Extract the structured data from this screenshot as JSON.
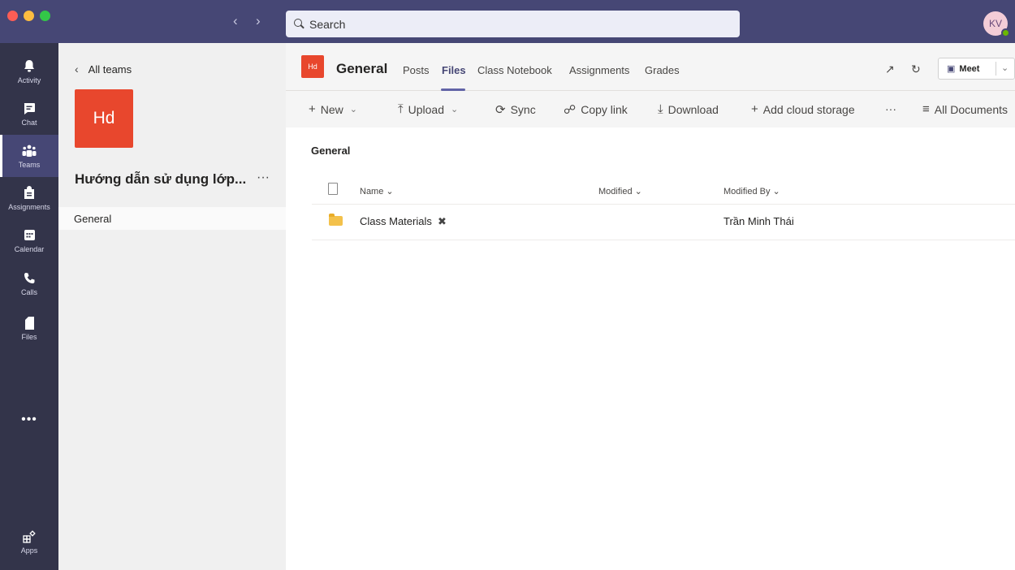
{
  "window": {
    "search_placeholder": "Search",
    "user_initials": "KV"
  },
  "app_bar": {
    "items": [
      {
        "label": "Activity",
        "icon": "bell-icon"
      },
      {
        "label": "Chat",
        "icon": "chat-icon"
      },
      {
        "label": "Teams",
        "icon": "teams-icon"
      },
      {
        "label": "Assignments",
        "icon": "assignments-icon"
      },
      {
        "label": "Calendar",
        "icon": "calendar-icon"
      },
      {
        "label": "Calls",
        "icon": "phone-icon"
      },
      {
        "label": "Files",
        "icon": "file-icon"
      }
    ],
    "more": "•••",
    "apps_label": "Apps"
  },
  "team_panel": {
    "back_label": "All teams",
    "team_initials": "Hd",
    "team_name": "Hướng dẫn sử dụng lớp...",
    "more": "···",
    "channels": [
      "General"
    ]
  },
  "header": {
    "channel_initials": "Hd",
    "channel_name": "General",
    "tabs": [
      "Posts",
      "Files",
      "Class Notebook",
      "Assignments",
      "Grades"
    ],
    "active_tab": "Files",
    "meet_label": "Meet"
  },
  "toolbar": {
    "new": "New",
    "upload": "Upload",
    "sync": "Sync",
    "copy_link": "Copy link",
    "download": "Download",
    "add_cloud": "Add cloud storage",
    "more": "···",
    "all_documents": "All Documents"
  },
  "files": {
    "breadcrumb": "General",
    "columns": {
      "name": "Name",
      "modified": "Modified",
      "modified_by": "Modified By"
    },
    "rows": [
      {
        "name": "Class Materials",
        "modified": "",
        "modified_by": "Trần Minh Thái"
      }
    ]
  },
  "colors": {
    "title_bar": "#464775",
    "app_bar": "#33344a",
    "accent": "#6264a7",
    "team_tile": "#e8472d"
  }
}
